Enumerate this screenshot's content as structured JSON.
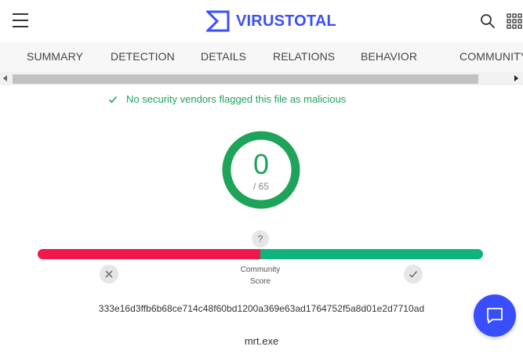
{
  "header": {
    "logo_text": "VIRUSTOTAL",
    "brand_color": "#394eff",
    "icons": [
      "hamburger-menu-icon",
      "virustotal-logo-icon",
      "search-icon",
      "apps-grid-icon"
    ]
  },
  "tabs": [
    {
      "label": "SUMMARY"
    },
    {
      "label": "DETECTION"
    },
    {
      "label": "DETAILS"
    },
    {
      "label": "RELATIONS"
    },
    {
      "label": "BEHAVIOR"
    },
    {
      "label": "COMMUNITY"
    }
  ],
  "summary": {
    "status_text": "No security vendors flagged this file as malicious",
    "status_color": "#1ea35a",
    "detection_score": "0",
    "detection_total": "/ 65"
  },
  "community": {
    "help_icon_text": "?",
    "label_line1": "Community",
    "label_line2": "Score",
    "negative_fraction": 0.5,
    "negative_color": "#f0174b",
    "positive_color": "#0fb47a"
  },
  "file": {
    "hash": "333e16d3ffb6b68ce714c48f60bd1200a369e63ad1764752f5a8d01e2d7710ad",
    "name": "mrt.exe"
  }
}
